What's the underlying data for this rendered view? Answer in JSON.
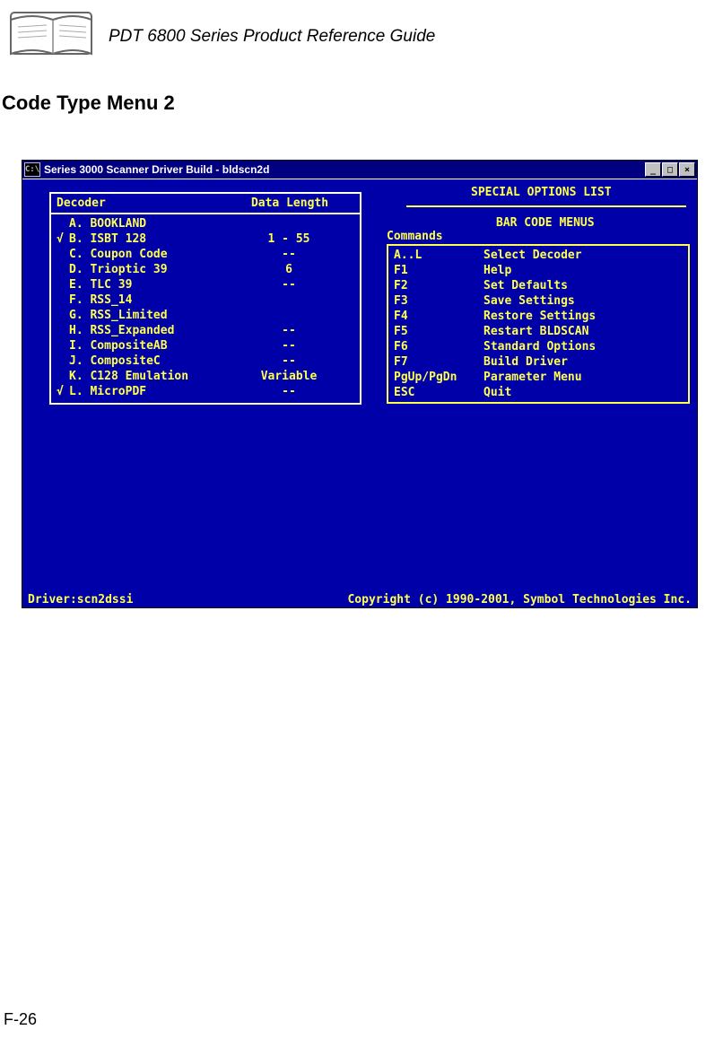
{
  "header": {
    "title": "PDT 6800 Series Product Reference Guide"
  },
  "section_title": "Code Type Menu 2",
  "window": {
    "title": "Series 3000 Scanner Driver Build - bldscn2d",
    "minimize": "_",
    "maximize": "□",
    "close": "×"
  },
  "special": {
    "title": "SPECIAL OPTIONS LIST",
    "subtitle": "BAR CODE MENUS",
    "commands_label": "Commands"
  },
  "decoder": {
    "header": {
      "col1": "Decoder",
      "col2": "Data Length"
    },
    "rows": [
      {
        "check": " ",
        "name": "A. BOOKLAND",
        "len": ""
      },
      {
        "check": "√",
        "name": "B. ISBT 128",
        "len": "1 - 55"
      },
      {
        "check": " ",
        "name": "C. Coupon Code",
        "len": "--"
      },
      {
        "check": " ",
        "name": "D. Trioptic 39",
        "len": "6"
      },
      {
        "check": " ",
        "name": "E. TLC 39",
        "len": "--"
      },
      {
        "check": " ",
        "name": "F. RSS_14",
        "len": ""
      },
      {
        "check": " ",
        "name": "G. RSS_Limited",
        "len": ""
      },
      {
        "check": " ",
        "name": "H. RSS_Expanded",
        "len": "--"
      },
      {
        "check": " ",
        "name": "I. CompositeAB",
        "len": "--"
      },
      {
        "check": " ",
        "name": "J. CompositeC",
        "len": "--"
      },
      {
        "check": " ",
        "name": "K. C128 Emulation",
        "len": "Variable"
      },
      {
        "check": "√",
        "name": "L. MicroPDF",
        "len": "--"
      }
    ]
  },
  "commands": [
    {
      "key": "A..L",
      "desc": "Select Decoder"
    },
    {
      "key": "F1",
      "desc": "Help"
    },
    {
      "key": "F2",
      "desc": "Set Defaults"
    },
    {
      "key": "F3",
      "desc": "Save Settings"
    },
    {
      "key": "F4",
      "desc": "Restore Settings"
    },
    {
      "key": "F5",
      "desc": "Restart BLDSCAN"
    },
    {
      "key": "F6",
      "desc": "Standard Options"
    },
    {
      "key": "F7",
      "desc": "Build Driver"
    },
    {
      "key": "PgUp/PgDn",
      "desc": "Parameter Menu"
    },
    {
      "key": "ESC",
      "desc": "Quit"
    }
  ],
  "footer": {
    "driver": "Driver:scn2dssi",
    "copyright": "Copyright (c) 1990-2001, Symbol Technologies Inc."
  },
  "page_number": "F-26"
}
